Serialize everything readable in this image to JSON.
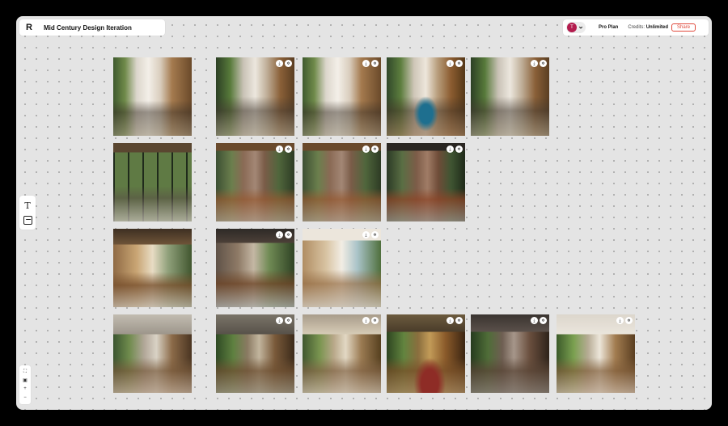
{
  "app": {
    "logo": "R",
    "title": "Mid Century Design Iteration"
  },
  "topbar": {
    "avatar_letter": "T",
    "plan_label": "Pro Plan",
    "credits_label": "Credits:",
    "credits_value": "Unlimited",
    "share_label": "Share"
  },
  "toolbar": {
    "text_tool": "T"
  },
  "zoom": {
    "fit": "⛶",
    "lock": "🔒",
    "plus": "+",
    "minus": "−"
  },
  "colors": {
    "accent": "#e0493b",
    "avatar": "#b31c4e",
    "canvas": "#e4e4e4"
  },
  "icons": [
    "download-icon",
    "remix-icon",
    "text-tool-icon",
    "image-tool-icon",
    "chevron-down-icon",
    "fit-view-icon",
    "lock-icon",
    "zoom-in-icon",
    "zoom-out-icon"
  ]
}
